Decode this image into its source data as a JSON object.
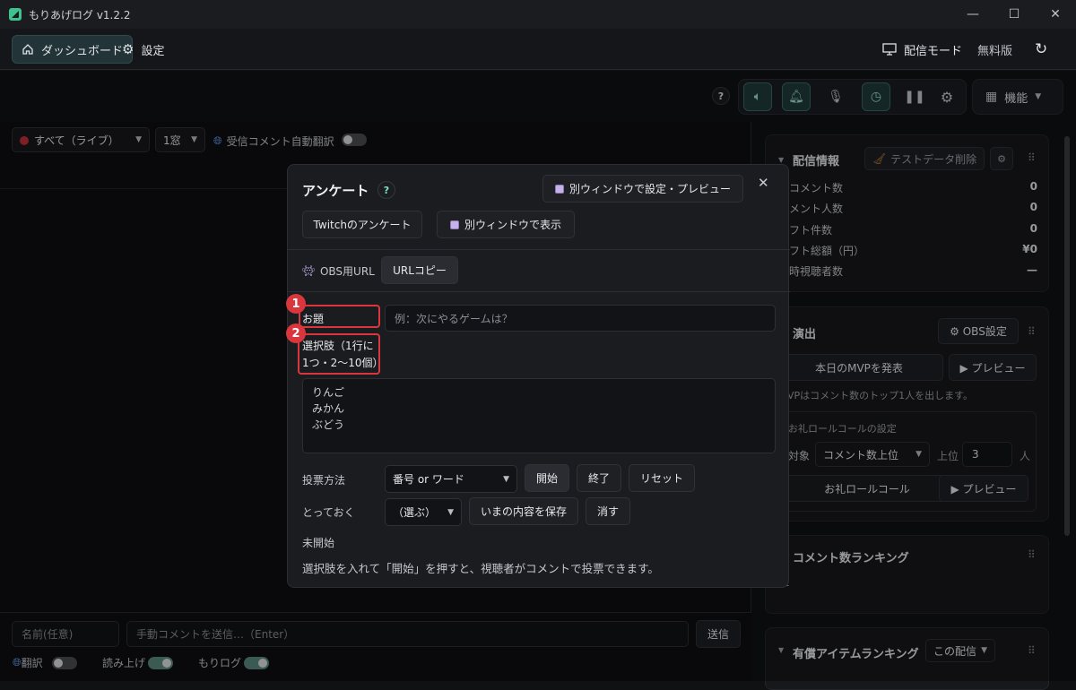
{
  "window": {
    "title": "もりあげログ  v1.2.2",
    "minimize": "—",
    "maximize": "☐",
    "close": "✕"
  },
  "nav": {
    "dashboard": "ダッシュボード",
    "settings": "設定",
    "stream_mode": "配信モード",
    "plan": "無料版"
  },
  "toolbar": {
    "help": "?",
    "features": "機能"
  },
  "filters": {
    "source": "すべて（ライブ）",
    "window": "1窓",
    "auto_translate": "受信コメント自動翻訳"
  },
  "bottom": {
    "name_placeholder": "名前(任意)",
    "comment_placeholder": "手動コメントを送信…（Enter）",
    "send": "送信",
    "translate": "翻訳",
    "read_aloud": "読み上げ",
    "morilog": "もりログ"
  },
  "stream_info": {
    "title": "配信情報",
    "delete_test": "テストデータ削除",
    "rows": [
      {
        "label": "コメント数",
        "value": "0"
      },
      {
        "label": "メント人数",
        "value": "0"
      },
      {
        "label": "フト件数",
        "value": "0"
      },
      {
        "label": "フト総額（円）",
        "value": "¥0"
      },
      {
        "label": "時視聴者数",
        "value": "—"
      }
    ]
  },
  "effects": {
    "title": "演出",
    "obs_settings": "⚙ OBS設定",
    "mvp_button": "本日のMVPを発表",
    "preview": "▶ プレビュー",
    "mvp_note": "VPはコメント数のトップ1人を出します。",
    "roll_title": "お礼ロールコールの設定",
    "target_label": "対象",
    "target_value": "コメント数上位",
    "top_label": "上位",
    "top_value": "3",
    "unit": "人",
    "roll_button": "お礼ロールコール",
    "roll_preview": "▶ プレビュー"
  },
  "ranking": {
    "comments_title": "コメント数ランキング",
    "comments_empty": "—",
    "paid_title": "有償アイテムランキング",
    "paid_scope": "この配信"
  },
  "modal": {
    "title": "アンケート",
    "help": "?",
    "open_window_settings": "別ウィンドウで設定・プレビュー",
    "twitch_poll": "Twitchのアンケート",
    "open_window": "別ウィンドウで表示",
    "obs_url_label": "OBS用URL",
    "copy_url": "URLコピー",
    "topic_label": "お題",
    "topic_placeholder": "例：次にやるゲームは？",
    "choices_label": "選択肢（1行に1つ・2〜10個）",
    "choices_line1": "選択肢（1行に",
    "choices_line2": "1つ・2〜10個）",
    "choices": [
      "りんご",
      "みかん",
      "ぶどう"
    ],
    "vote_method_label": "投票方法",
    "vote_method_value": "番号 or ワード",
    "start": "開始",
    "end": "終了",
    "reset": "リセット",
    "keep_label": "とっておく",
    "keep_value": "（選ぶ）",
    "save_current": "いまの内容を保存",
    "delete": "消す",
    "status": "未開始",
    "hint": "選択肢を入れて「開始」を押すと、視聴者がコメントで投票できます。",
    "close": "✕"
  },
  "annotations": {
    "badge1": "1",
    "badge2": "2"
  },
  "colors": {
    "accent": "#3ec28e",
    "annotation_red": "#d9363e",
    "bg": "#101113",
    "panel": "#17181b"
  }
}
